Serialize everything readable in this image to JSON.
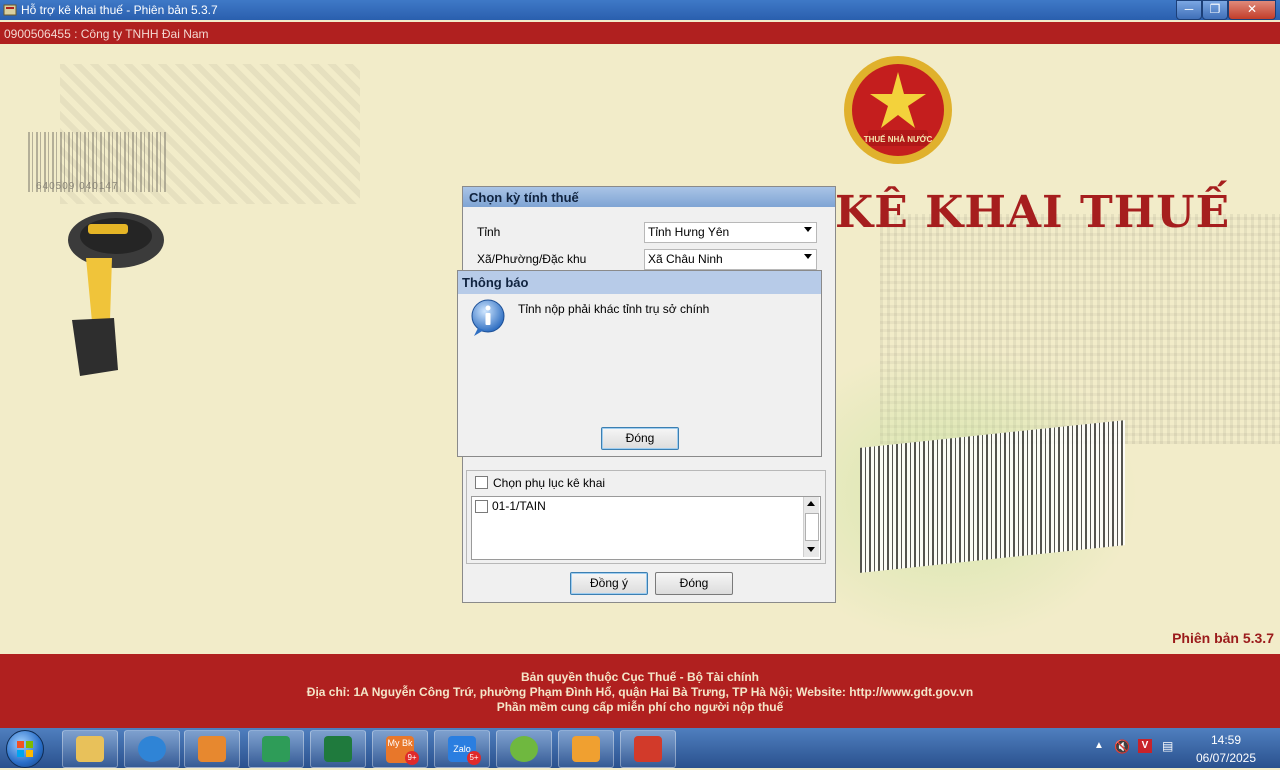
{
  "window": {
    "title": "Hỗ trợ kê khai thuế -  Phiên bản 5.3.7",
    "min_icon": "minimize-icon",
    "max_icon": "maximize-icon",
    "close_icon": "close-icon"
  },
  "header": {
    "company": "0900506455 : Công ty TNHH Đai Nam"
  },
  "branding": {
    "emblem_text": "THUẾ NHÀ NƯỚC",
    "big_title": "KÊ KHAI THUẾ",
    "barcode_number": "640509 040147",
    "version": "Phiên bản 5.3.7"
  },
  "period_dialog": {
    "title": "Chọn kỳ tính thuế",
    "province_label": "Tỉnh",
    "province_value": "Tỉnh Hưng Yên",
    "ward_label": "Xã/Phường/Đặc khu",
    "ward_value": "Xã Châu Ninh",
    "appendix_label": "Chọn phụ lục kê khai",
    "appendix_items": [
      {
        "label": "01-1/TAIN",
        "checked": false
      }
    ],
    "ok_label": "Đồng ý",
    "close_label": "Đóng"
  },
  "message_box": {
    "title": "Thông báo",
    "text": "Tỉnh nộp phải khác tỉnh trụ sở chính",
    "close_label": "Đóng",
    "icon": "info-icon"
  },
  "footer": {
    "line1": "Bản quyền thuộc Cục Thuế - Bộ Tài chính",
    "line2": "Địa chỉ: 1A Nguyễn Công Trứ, phường Phạm Đình Hổ, quận Hai Bà Trưng, TP Hà Nội; Website: http://www.gdt.gov.vn",
    "line3": "Phần mềm cung cấp miễn phí cho người nộp thuế"
  },
  "taskbar": {
    "apps": [
      {
        "name": "file-explorer",
        "color": "#e8c15a"
      },
      {
        "name": "internet-explorer",
        "color": "#2f84d6"
      },
      {
        "name": "media-player",
        "color": "#e7882f"
      },
      {
        "name": "app-home",
        "color": "#2e9c58"
      },
      {
        "name": "excel",
        "color": "#1f7a3d"
      },
      {
        "name": "mybk",
        "color": "#e8772a"
      },
      {
        "name": "zalo",
        "color": "#2a7ee0"
      },
      {
        "name": "app-green",
        "color": "#6fb83f"
      },
      {
        "name": "app-fox",
        "color": "#f0a030"
      },
      {
        "name": "htkk",
        "color": "#d23a2a"
      }
    ],
    "badges": {
      "mybk": "9+",
      "zalo": "5+"
    },
    "mybk_label": "My Bk",
    "zalo_label": "Zalo",
    "time": "14:59",
    "date": "06/07/2025"
  },
  "colors": {
    "brand_red": "#b0201f",
    "background": "#f2ecc9",
    "title_red": "#a61e1e"
  }
}
